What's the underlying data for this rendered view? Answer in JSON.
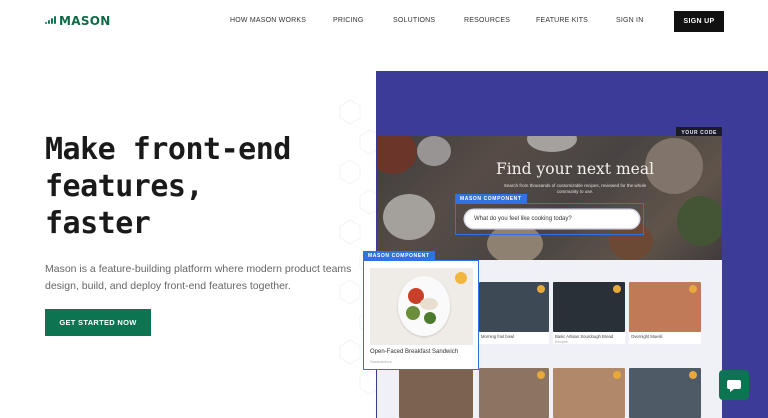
{
  "brand": {
    "name": "MASON"
  },
  "nav": {
    "items": [
      "HOW MASON WORKS",
      "PRICING",
      "SOLUTIONS",
      "RESOURCES",
      "FEATURE KITS",
      "SIGN IN"
    ],
    "signup_label": "SIGN UP"
  },
  "hero": {
    "title_lines": [
      "Make front-end",
      "features,",
      "faster"
    ],
    "description": "Mason is a feature-building platform where modern product teams design, build, and deploy front-end features together.",
    "cta_label": "GET STARTED NOW"
  },
  "preview": {
    "your_code_label": "YOUR CODE",
    "component_label": "MASON COMPONENT",
    "hero_title": "Find your next meal",
    "hero_subtitle": "Search from thousands of customizable recipes, reviewed for the whole community to use.",
    "search_placeholder": "What do you feel like cooking today?",
    "cards": [
      {
        "caption": "Morning fruit bowl",
        "sub": ""
      },
      {
        "caption": "Basic Artisan Sourdough Bread",
        "sub": "Recipes"
      },
      {
        "caption": "Overnight Muesli",
        "sub": ""
      }
    ],
    "featured_card": {
      "title": "Open-Faced Breakfast Sandwich",
      "sub": "Sandwiches"
    }
  },
  "colors": {
    "brand_green": "#0d7452",
    "panel_purple": "#3c3b98",
    "component_blue": "#2e72e4"
  },
  "icons": {
    "chat": "chat-bubble-icon",
    "logo": "mason-logo-icon"
  }
}
